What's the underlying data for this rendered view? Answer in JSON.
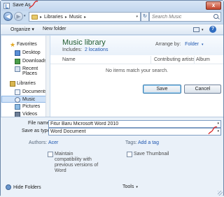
{
  "window": {
    "title": "Save As",
    "close_glyph": "x"
  },
  "address": {
    "segments": [
      "Libraries",
      "Music"
    ],
    "separator": "▸",
    "back_glyph": "◀",
    "forward_glyph": "▶",
    "refresh_glyph": "↻",
    "search_placeholder": "Search Music"
  },
  "toolbar": {
    "organize": "Organize ▾",
    "new_folder": "New folder",
    "help": "?"
  },
  "nav": {
    "items": [
      {
        "label": "Favorites",
        "icon": "star-icon"
      },
      {
        "label": "Desktop",
        "icon": "desktop-icon"
      },
      {
        "label": "Downloads",
        "icon": "downloads-icon"
      },
      {
        "label": "Recent Places",
        "icon": "recent-places-icon"
      },
      {
        "label": "Libraries",
        "icon": "libraries-icon"
      },
      {
        "label": "Documents",
        "icon": "documents-icon"
      },
      {
        "label": "Music",
        "icon": "music-icon",
        "selected": true
      },
      {
        "label": "Pictures",
        "icon": "pictures-icon"
      },
      {
        "label": "Videos",
        "icon": "videos-icon"
      }
    ]
  },
  "library": {
    "title": "Music library",
    "includes_label": "Includes:",
    "includes_link": "2 locations",
    "arrange_label": "Arrange by:",
    "arrange_value": "Folder",
    "columns": [
      "Name",
      "Contributing artists",
      "Album"
    ],
    "empty_message": "No items match your search."
  },
  "form": {
    "file_name_label": "File name:",
    "file_name_value": "Fitur Baru Microsoft Word 2010",
    "save_as_type_label": "Save as type:",
    "save_as_type_value": "Word Document",
    "authors_label": "Authors:",
    "authors_value": "Acer",
    "tags_label": "Tags:",
    "tags_value": "Add a tag",
    "maintain_compat": [
      "Maintain",
      "compatibility with",
      "previous versions of",
      "Word"
    ],
    "save_thumbnail": "Save Thumbnail"
  },
  "footer": {
    "hide_folders": "Hide Folders",
    "tools": "Tools",
    "save": "Save",
    "cancel": "Cancel"
  },
  "colors": {
    "accent": "#1f57b0",
    "title_green": "#1f5b2f",
    "annotation_red": "#d81e1e"
  }
}
